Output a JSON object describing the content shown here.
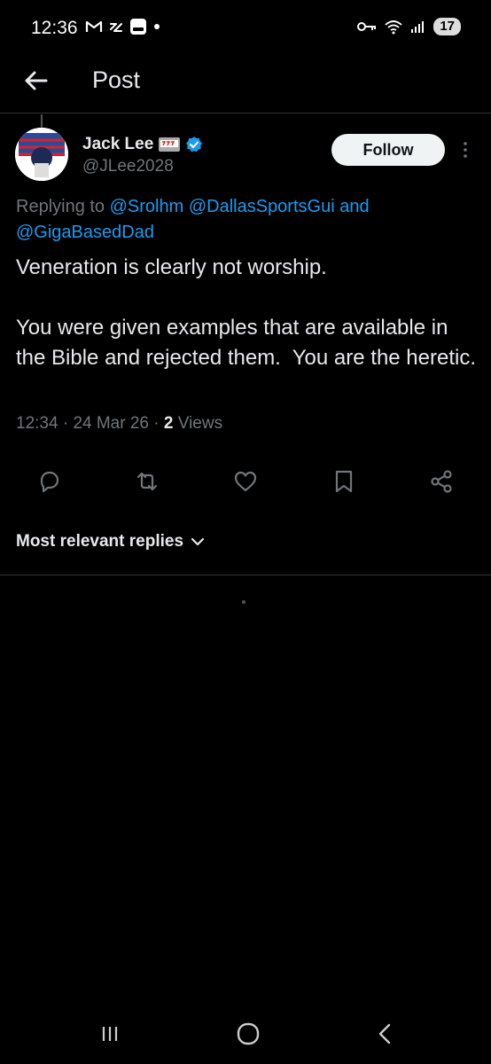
{
  "status_bar": {
    "time": "12:36",
    "battery": "17"
  },
  "header": {
    "title": "Post"
  },
  "author": {
    "name": "Jack Lee",
    "handle": "@JLee2028",
    "verified": true
  },
  "follow_label": "Follow",
  "reply": {
    "prefix": "Replying to ",
    "mentions": [
      "@Srolhm",
      "@DallasSportsGui",
      "@GigaBasedDad"
    ],
    "joiner": " and"
  },
  "post": {
    "text": "Veneration is clearly not worship.\n\nYou were given examples that are available in the Bible and rejected them.  You are the heretic.",
    "time": "12:34",
    "date": "24 Mar 26",
    "views_count": "2",
    "views_label": "Views"
  },
  "sort_label": "Most relevant replies",
  "colors": {
    "accent": "#1d9bf0",
    "background": "#000000",
    "text": "#e7e9ea",
    "muted": "#71767b"
  },
  "icons": {
    "actions": [
      "reply-icon",
      "repost-icon",
      "like-icon",
      "bookmark-icon",
      "share-icon"
    ],
    "navigation": [
      "recents-icon",
      "home-icon",
      "back-icon"
    ]
  }
}
